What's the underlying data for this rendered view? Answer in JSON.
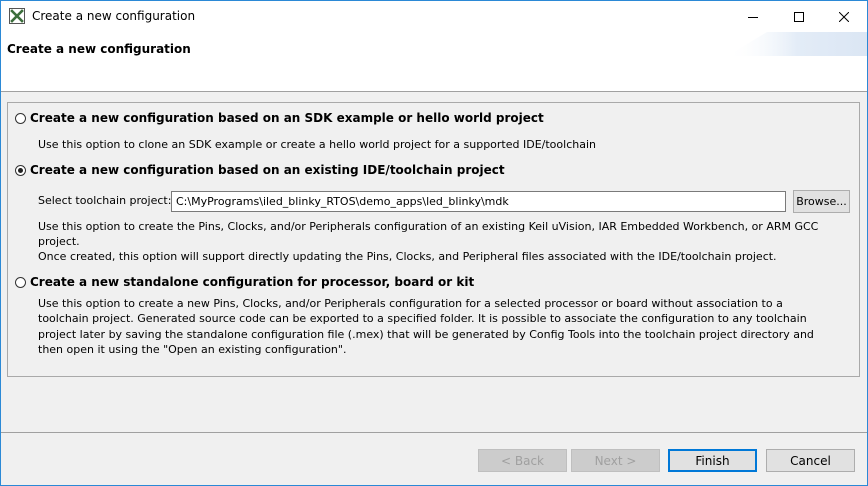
{
  "window": {
    "title": "Create a new configuration"
  },
  "header": {
    "title": "Create a new configuration"
  },
  "options": [
    {
      "label": "Create a new configuration based on an SDK example or hello world project",
      "selected": false,
      "description": "Use this option to clone an SDK example or create a hello world project for a supported IDE/toolchain"
    },
    {
      "label": "Create a new configuration based on an existing IDE/toolchain project",
      "selected": true,
      "field_label": "Select toolchain project:",
      "field_value": "C:\\MyPrograms\\iled_blinky_RTOS\\demo_apps\\led_blinky\\mdk",
      "browse_label": "Browse...",
      "description_line1": "Use this option to create the Pins, Clocks, and/or Peripherals configuration of an existing Keil uVision, IAR Embedded Workbench, or ARM GCC project.",
      "description_line2": "Once created, this option will support directly updating the Pins, Clocks, and Peripheral files associated with the IDE/toolchain project."
    },
    {
      "label": "Create a new standalone configuration for processor, board or kit",
      "selected": false,
      "description": "Use this option to create a new Pins, Clocks, and/or Peripherals configuration for a selected processor or board without association to a toolchain project. Generated source code can be exported to a specified folder. It is possible to associate the configuration to any toolchain project later by saving the standalone configuration file (.mex) that will be generated by Config Tools into the toolchain project directory and then open it using the \"Open an existing configuration\"."
    }
  ],
  "footer": {
    "back_label": "< Back",
    "next_label": "Next >",
    "finish_label": "Finish",
    "cancel_label": "Cancel"
  },
  "colors": {
    "window_border": "#2b89d6",
    "default_button_border": "#0078d7",
    "app_icon": "#3c6e3c"
  }
}
